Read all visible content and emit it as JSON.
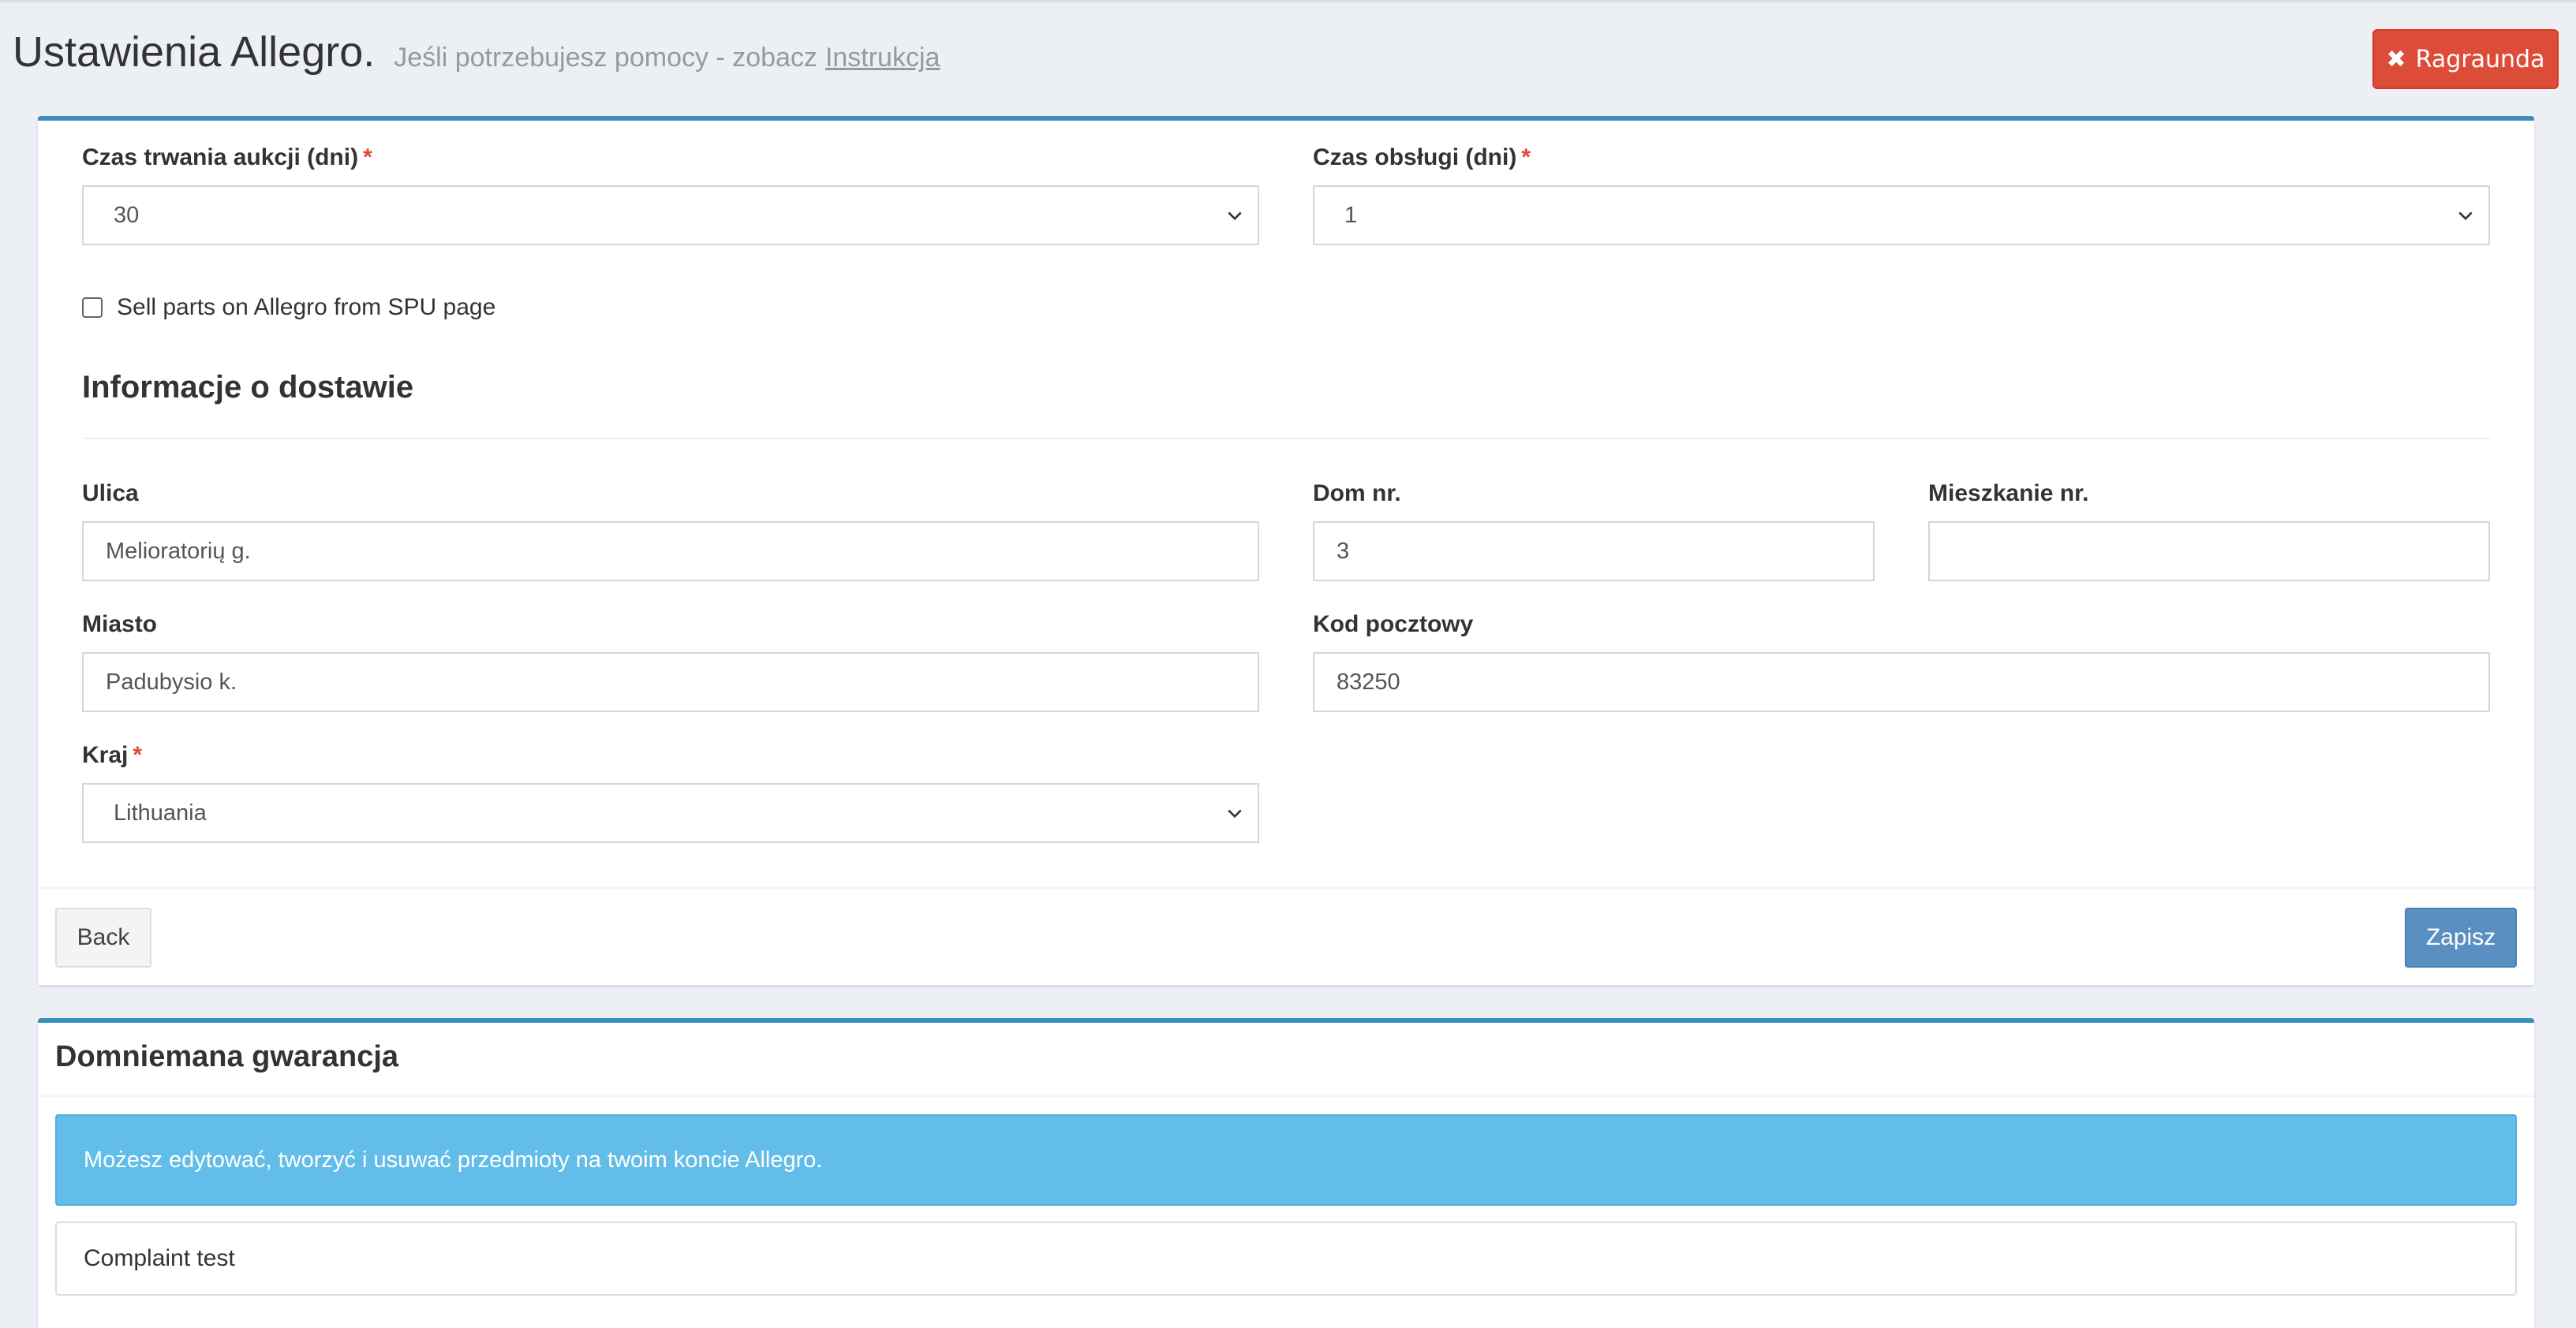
{
  "header": {
    "title": "Ustawienia Allegro.",
    "subtitle": "Jeśli potrzebujesz pomocy - zobacz",
    "help_link": "Instrukcja",
    "close_button": "Ragraunda"
  },
  "form": {
    "auction_duration": {
      "label": "Czas trwania aukcji (dni)",
      "required_mark": "*",
      "value": "30"
    },
    "handling_time": {
      "label": "Czas obsługi (dni)",
      "required_mark": "*",
      "value": "1"
    },
    "sell_parts_checkbox": {
      "label": "Sell parts on Allegro from SPU page",
      "checked": false
    },
    "delivery_section_title": "Informacje o dostawie",
    "street": {
      "label": "Ulica",
      "value": "Melioratorių g."
    },
    "house_no": {
      "label": "Dom nr.",
      "value": "3"
    },
    "apartment_no": {
      "label": "Mieszkanie nr.",
      "value": ""
    },
    "city": {
      "label": "Miasto",
      "value": "Padubysio k."
    },
    "postal_code": {
      "label": "Kod pocztowy",
      "value": "83250"
    },
    "country": {
      "label": "Kraj",
      "required_mark": "*",
      "value": "Lithuania"
    },
    "back_button": "Back",
    "save_button": "Zapisz"
  },
  "warranty": {
    "title": "Domniemana gwarancja",
    "info_message": "Możesz edytować, tworzyć i usuwać przedmioty na twoim koncie Allegro.",
    "items": [
      "Complaint test"
    ]
  },
  "colors": {
    "accent": "#3c8dbc",
    "danger": "#dd4b39",
    "primary": "#5a8fc2",
    "info": "#63bde9"
  }
}
